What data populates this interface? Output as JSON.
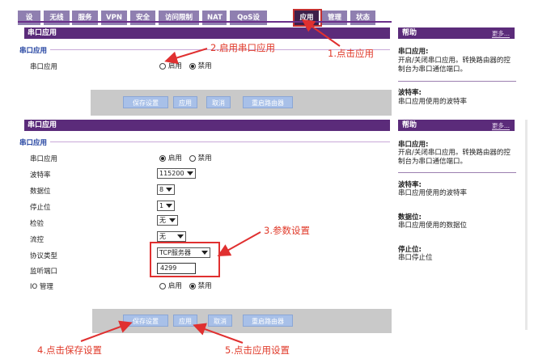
{
  "nav": {
    "tabs": [
      {
        "label": "设置"
      },
      {
        "label": "无线"
      },
      {
        "label": "服务"
      },
      {
        "label": "VPN"
      },
      {
        "label": "安全"
      },
      {
        "label": "访问限制"
      },
      {
        "label": "NAT"
      },
      {
        "label": "QoS设置"
      },
      {
        "label": "应用",
        "active": true
      },
      {
        "label": "管理"
      },
      {
        "label": "状态"
      }
    ]
  },
  "panel1": {
    "header": "串口应用",
    "section_title": "串口应用",
    "row_label": "串口应用",
    "enable_label": "启用",
    "disable_label": "禁用",
    "selected": "禁用"
  },
  "panel2": {
    "header": "串口应用",
    "section_title": "串口应用",
    "rows": {
      "serial_app": {
        "label": "串口应用",
        "enable": "启用",
        "disable": "禁用",
        "selected": "启用"
      },
      "baud": {
        "label": "波特率",
        "value": "115200"
      },
      "data_bits": {
        "label": "数据位",
        "value": "8"
      },
      "stop_bits": {
        "label": "停止位",
        "value": "1"
      },
      "parity": {
        "label": "检验",
        "value": "无"
      },
      "flow": {
        "label": "流控",
        "value": "无"
      },
      "protocol": {
        "label": "协议类型",
        "value": "TCP服务器"
      },
      "port": {
        "label": "监听端口",
        "value": "4299"
      },
      "io": {
        "label": "IO 管理",
        "enable": "启用",
        "disable": "禁用",
        "selected": "禁用"
      }
    }
  },
  "buttons": {
    "save": "保存设置",
    "apply": "应用",
    "cancel": "取消",
    "reboot": "重启路由器"
  },
  "help1": {
    "header": "帮助",
    "more": "更多...",
    "t1": "串口应用:",
    "d1": "开启/关闭串口应用。转换路由器的控制台为串口通信端口。",
    "t2": "波特率:",
    "d2": "串口应用使用的波特率"
  },
  "help2": {
    "header": "帮助",
    "more": "更多...",
    "t1": "串口应用:",
    "d1": "开启/关闭串口应用。转换路由器的控制台为串口通信端口。",
    "t2": "波特率:",
    "d2": "串口应用使用的波特率",
    "t3": "数据位:",
    "d3": "串口应用使用的数据位",
    "t4": "停止位:",
    "d4": "串口停止位"
  },
  "annotations": {
    "a1": "1.点击应用",
    "a2": "2.启用串口应用",
    "a3": "3.参数设置",
    "a4": "4.点击保存设置",
    "a5": "5.点击应用设置"
  },
  "colors": {
    "accent": "#5b2b7a",
    "annotation": "#e03030",
    "button": "#a8c0e8"
  }
}
